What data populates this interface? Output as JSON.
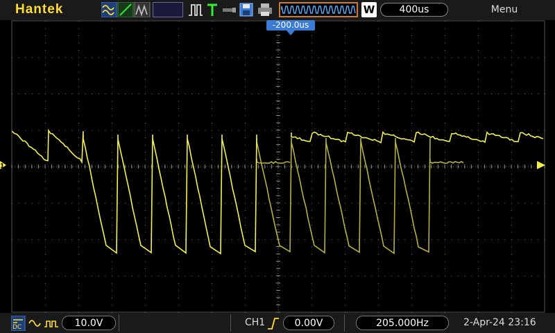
{
  "header": {
    "brand": "Hantek",
    "trigger_offset": "-200.0us",
    "mode_label": "W",
    "timebase": "400us",
    "menu_label": "Menu"
  },
  "icons": {
    "waveform_types": "sine-square-ramp-icon",
    "run": "run-pulse-icon",
    "trigger": "trigger-T-icon",
    "usb": "usb-icon",
    "save": "floppy-save-icon",
    "print": "printer-icon"
  },
  "footer": {
    "coupling": "DC",
    "probe_scale": "10.0V",
    "channel": "CH1",
    "trigger_level": "0.00V",
    "frequency": "205.000Hz",
    "datetime": "2-Apr-24 23:16"
  },
  "colors": {
    "trace": "#f6f24a",
    "trace_dim": "#b9b23a",
    "accent_blue": "#3a7bd5",
    "grid": "#5a5a5a"
  }
}
